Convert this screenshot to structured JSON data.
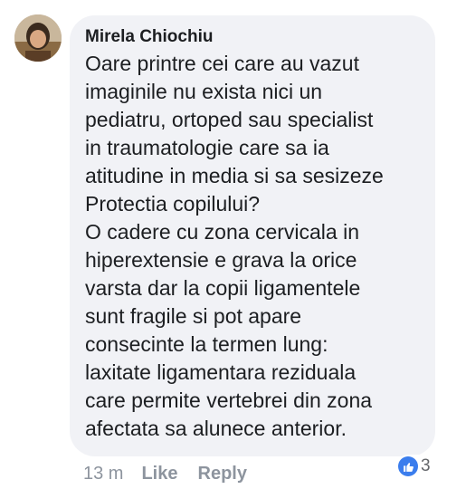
{
  "comment": {
    "author": "Mirela Chiochiu",
    "lines": [
      "Oare printre cei care au vazut",
      "imaginile nu exista nici un",
      "pediatru, ortoped sau specialist",
      "in traumatologie care sa ia",
      "atitudine in media si sa sesizeze",
      "Protectia copilului?",
      "O cadere cu zona cervicala in",
      "hiperextensie e grava la orice",
      "varsta dar la copii ligamentele",
      "sunt fragile si pot apare",
      "consecinte la termen lung:",
      "laxitate ligamentara reziduala",
      "care permite vertebrei din zona",
      "afectata sa alunece anterior."
    ]
  },
  "meta": {
    "time": "13 m",
    "like_label": "Like",
    "reply_label": "Reply"
  },
  "reactions": {
    "icon": "thumbs-up-icon",
    "count": "3",
    "color": "#3b7ded"
  }
}
